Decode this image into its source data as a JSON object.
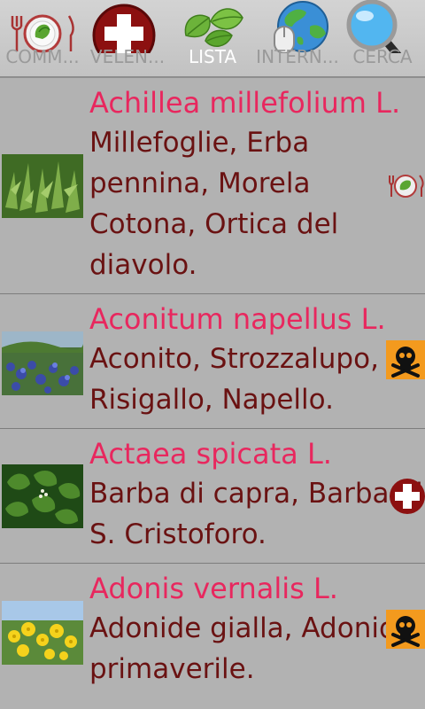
{
  "tabs": [
    {
      "label": "COMM...",
      "icon": "cutlery-plate-icon",
      "active": false
    },
    {
      "label": "VELEN...",
      "icon": "red-cross-icon",
      "active": false
    },
    {
      "label": "LISTA",
      "icon": "basil-leaves-icon",
      "active": true
    },
    {
      "label": "INTERN...",
      "icon": "globe-mouse-icon",
      "active": false
    },
    {
      "label": "CERCA",
      "icon": "magnifier-icon",
      "active": false
    }
  ],
  "plants": [
    {
      "latin": "Achillea millefolium L.",
      "common": "Millefoglie, Erba pennina, Morela Cotona, Ortica del diavolo.",
      "badge": "edible-icon"
    },
    {
      "latin": "Aconitum napellus L.",
      "common": "Aconito, Strozzalupo, Risigallo, Napello.",
      "badge": "poison-skull-icon"
    },
    {
      "latin": "Actaea spicata L.",
      "common": "Barba di capra, Barba di S. Cristoforo.",
      "badge": "medicinal-cross-icon"
    },
    {
      "latin": "Adonis vernalis L.",
      "common": "Adonide gialla, Adonide primaverile.",
      "badge": "poison-skull-icon"
    }
  ],
  "colors": {
    "latin_name": "#e8275e",
    "common_name": "#6a1212",
    "background": "#b2b2b2",
    "active_tab_label": "#ffffff",
    "inactive_tab_label": "#9a9a9a"
  }
}
